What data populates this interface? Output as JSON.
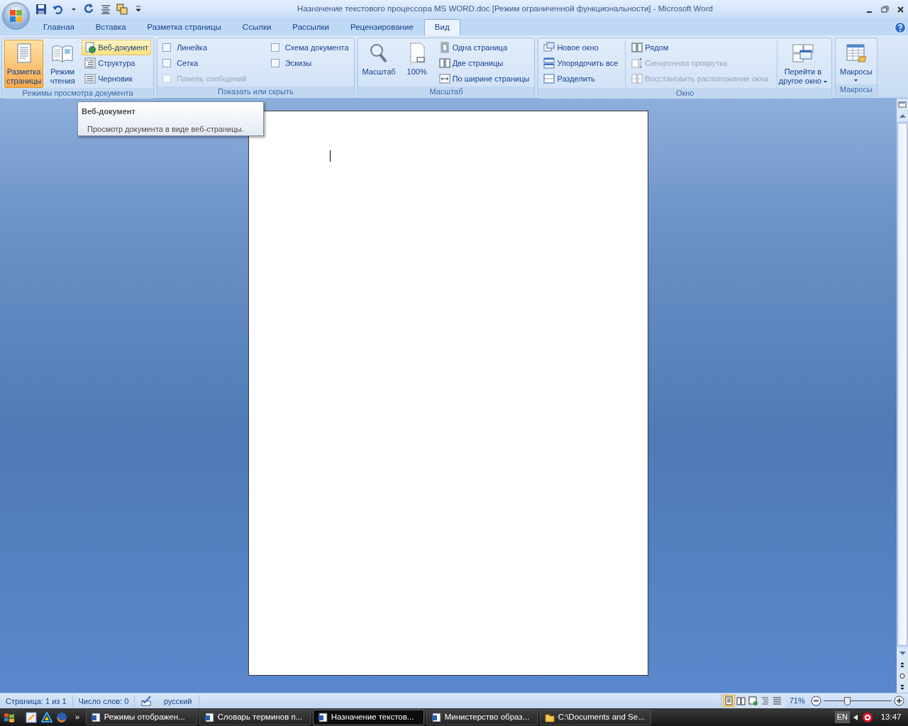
{
  "window": {
    "title": "Назначение текстового процессора MS  WORD.doc [Режим ограниченной функциональности] - Microsoft Word"
  },
  "tabs": [
    {
      "label": "Главная",
      "selected": false
    },
    {
      "label": "Вставка",
      "selected": false
    },
    {
      "label": "Разметка страницы",
      "selected": false
    },
    {
      "label": "Ссылки",
      "selected": false
    },
    {
      "label": "Рассылки",
      "selected": false
    },
    {
      "label": "Рецензирование",
      "selected": false
    },
    {
      "label": "Вид",
      "selected": true
    }
  ],
  "ribbon": {
    "groups": [
      {
        "title": "Режимы просмотра документа",
        "parts": [
          {
            "kind": "big",
            "lines": [
              "Разметка",
              "страницы"
            ],
            "selected": true,
            "dropdown": false
          },
          {
            "kind": "big",
            "lines": [
              "Режим",
              "чтения"
            ],
            "selected": false,
            "dropdown": false
          },
          {
            "kind": "column",
            "items": [
              {
                "label": "Веб-документ",
                "hovered": true,
                "disabled": false
              },
              {
                "label": "Структура",
                "hovered": false,
                "disabled": false
              },
              {
                "label": "Черновик",
                "hovered": false,
                "disabled": false
              }
            ]
          }
        ]
      },
      {
        "title": "Показать или скрыть",
        "parts": [
          {
            "kind": "checks",
            "items": [
              {
                "label": "Линейка",
                "checked": false,
                "disabled": false
              },
              {
                "label": "Сетка",
                "checked": false,
                "disabled": false
              },
              {
                "label": "Панель сообщений",
                "checked": false,
                "disabled": true
              }
            ]
          },
          {
            "kind": "checks",
            "items": [
              {
                "label": "Схема документа",
                "checked": false,
                "disabled": false
              },
              {
                "label": "Эскизы",
                "checked": false,
                "disabled": false
              }
            ]
          }
        ]
      },
      {
        "title": "Масштаб",
        "parts": [
          {
            "kind": "big",
            "lines": [
              "Масштаб"
            ],
            "selected": false,
            "dropdown": false
          },
          {
            "kind": "big",
            "lines": [
              "100%"
            ],
            "selected": false,
            "dropdown": false
          },
          {
            "kind": "column",
            "items": [
              {
                "label": "Одна страница",
                "hovered": false,
                "disabled": false
              },
              {
                "label": "Две страницы",
                "hovered": false,
                "disabled": false
              },
              {
                "label": "По ширине страницы",
                "hovered": false,
                "disabled": false
              }
            ]
          }
        ]
      },
      {
        "title": "Окно",
        "parts": [
          {
            "kind": "column",
            "items": [
              {
                "label": "Новое окно",
                "hovered": false,
                "disabled": false
              },
              {
                "label": "Упорядочить все",
                "hovered": false,
                "disabled": false
              },
              {
                "label": "Разделить",
                "hovered": false,
                "disabled": false
              }
            ]
          },
          {
            "kind": "column",
            "items": [
              {
                "label": "Рядом",
                "hovered": false,
                "disabled": false
              },
              {
                "label": "Синхронная прокрутка",
                "hovered": false,
                "disabled": true
              },
              {
                "label": "Восстановить расположение окна",
                "hovered": false,
                "disabled": true
              }
            ]
          },
          {
            "kind": "big",
            "lines": [
              "Перейти в",
              "другое окно"
            ],
            "selected": false,
            "dropdown": true
          }
        ]
      },
      {
        "title": "Макросы",
        "parts": [
          {
            "kind": "big",
            "lines": [
              "Макросы"
            ],
            "selected": false,
            "dropdown": true
          }
        ]
      }
    ]
  },
  "tooltip": {
    "title": "Веб-документ",
    "text": "Просмотр документа в виде веб-страницы."
  },
  "status_bar": {
    "fields": [
      "Страница: 1 из 1",
      "Число слов: 0"
    ],
    "language": "русский",
    "view_buttons": [
      {
        "selected": true
      },
      {
        "selected": false
      },
      {
        "selected": false
      },
      {
        "selected": false
      },
      {
        "selected": false
      }
    ],
    "zoom": "71%",
    "zoom_slider": {
      "level": 0.35
    }
  },
  "taskbar": {
    "more": "»",
    "buttons": [
      {
        "label": "Режимы отображен...",
        "selected": false
      },
      {
        "label": "Словарь терминов п...",
        "selected": false
      },
      {
        "label": "Назначение текстов...",
        "selected": true
      },
      {
        "label": "Министерство образ...",
        "selected": false
      },
      {
        "label": "C:\\Documents and Se...",
        "selected": false
      }
    ],
    "language": "EN",
    "clock": "13:47"
  }
}
